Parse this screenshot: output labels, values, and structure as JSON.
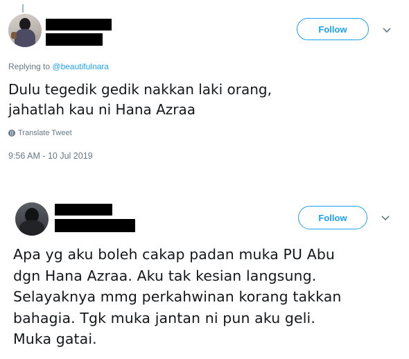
{
  "tweets": [
    {
      "follow_label": "Follow",
      "replying_prefix": "Replying to",
      "replying_handle": "@beautifulnara",
      "text_lines": [
        "Dulu tegedik gedik nakkan laki orang,",
        "jahatlah kau ni Hana Azraa"
      ],
      "translate_label": "Translate Tweet",
      "timestamp": "9:56 AM - 10 Jul 2019"
    },
    {
      "follow_label": "Follow",
      "text_lines": [
        "Apa yg aku boleh cakap padan muka PU Abu",
        "dgn Hana Azraa. Aku tak kesian langsung.",
        "Selayaknya mmg perkahwinan korang takkan",
        "bahagia. Tgk muka jantan ni pun aku geli.",
        "Muka gatai."
      ]
    }
  ],
  "colors": {
    "accent": "#1da1f2",
    "secondary_text": "#657786",
    "primary_text": "#14171a"
  },
  "icons": [
    "globe-icon",
    "chevron-down-icon"
  ]
}
